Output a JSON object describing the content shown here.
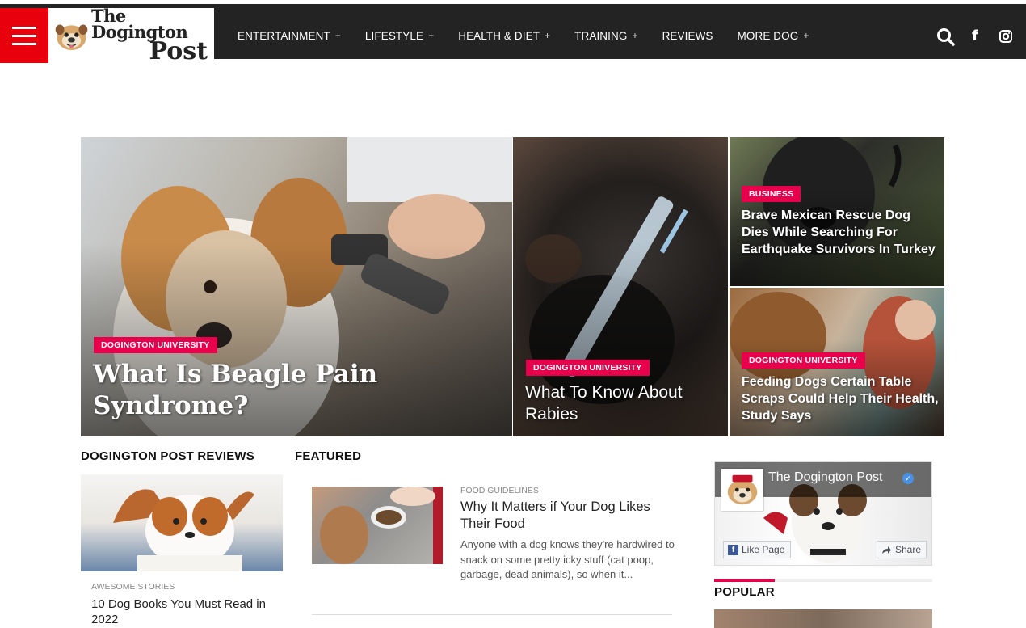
{
  "header": {
    "menu_icon": "hamburger-icon",
    "logo": {
      "line1": "The Dogington",
      "line2": "Post"
    },
    "nav": [
      {
        "label": "ENTERTAINMENT",
        "has_submenu": true
      },
      {
        "label": "LIFESTYLE",
        "has_submenu": true
      },
      {
        "label": "HEALTH & DIET",
        "has_submenu": true
      },
      {
        "label": "TRAINING",
        "has_submenu": true
      },
      {
        "label": "REVIEWS",
        "has_submenu": false
      },
      {
        "label": "MORE DOG",
        "has_submenu": true
      }
    ],
    "submenu_marker": "+",
    "icons": [
      "search-icon",
      "facebook-icon",
      "instagram-icon"
    ],
    "facebook_glyph": "f"
  },
  "hero": [
    {
      "category": "DOGINGTON UNIVERSITY",
      "title": "What Is Beagle Pain Syndrome?"
    },
    {
      "category": "DOGINGTON UNIVERSITY",
      "title": "What To Know About Rabies"
    },
    {
      "category": "BUSINESS",
      "title": "Brave Mexican Rescue Dog Dies While Searching For Earthquake Survivors In Turkey"
    },
    {
      "category": "DOGINGTON UNIVERSITY",
      "title": "Feeding Dogs Certain Table Scraps Could Help Their Health, Study Says"
    }
  ],
  "reviews": {
    "heading": "DOGINGTON POST REVIEWS",
    "item": {
      "category": "AWESOME STORIES",
      "title": "10 Dog Books You Must Read in 2022"
    }
  },
  "featured": {
    "heading": "FEATURED",
    "item": {
      "category": "FOOD GUIDELINES",
      "title": "Why It Matters if Your Dog Likes Their Food",
      "excerpt": "Anyone with a dog knows they're hardwired to snack on some pretty icky stuff (cat poop, garbage, dead animals), so when it..."
    }
  },
  "facebook_widget": {
    "page_name": "The Dogington Post",
    "like_label": "Like Page",
    "share_label": "Share",
    "like_glyph": "f",
    "verified_glyph": "✓"
  },
  "popular": {
    "heading": "POPULAR"
  },
  "colors": {
    "accent_red": "#e8000d",
    "badge_pink": "#e8004c",
    "topbar": "#232323"
  }
}
